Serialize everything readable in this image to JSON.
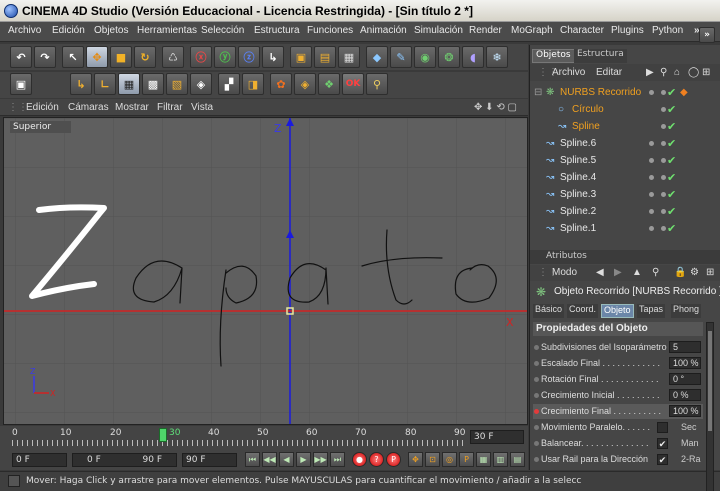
{
  "titlebar": {
    "title": "CINEMA 4D Studio (Versión Educacional - Licencia Restringida) - [Sin título 2 *]"
  },
  "menu": [
    "Archivo",
    "Edición",
    "Objetos",
    "Herramientas",
    "Selección",
    "Estructura",
    "Funciones",
    "Animación",
    "Simulación",
    "Render",
    "MoGraph",
    "Character",
    "Plugins",
    "Python"
  ],
  "viewport": {
    "menu": [
      "Edición",
      "Cámaras",
      "Mostrar",
      "Filtrar",
      "Vista"
    ],
    "label": "Superior",
    "axis_z": "Z",
    "axis_x": "X",
    "handwritten_text": "Zapato"
  },
  "timeline": {
    "ticks": [
      "0",
      "10",
      "20",
      "30",
      "40",
      "50",
      "60",
      "70",
      "80",
      "90"
    ],
    "current_frame": "30",
    "end_field": "30 F",
    "start_field": "0 F",
    "min_field": "0 F",
    "max_field": "90 F",
    "len_field": "90 F"
  },
  "status": "Mover: Haga Click y arrastre para mover elementos. Pulse MAYUSCULAS para cuantificar el movimiento / añadir a la selecc",
  "objects_panel": {
    "tabs": [
      "Objetos",
      "Estructura"
    ],
    "menu": [
      "Archivo",
      "Editar"
    ],
    "items": [
      {
        "name": "NURBS Recorrido",
        "highlight": true
      },
      {
        "name": "Círculo",
        "child": true
      },
      {
        "name": "Spline",
        "child": true
      },
      {
        "name": "Spline.6"
      },
      {
        "name": "Spline.5"
      },
      {
        "name": "Spline.4"
      },
      {
        "name": "Spline.3"
      },
      {
        "name": "Spline.2"
      },
      {
        "name": "Spline.1"
      }
    ]
  },
  "attributes_panel": {
    "header": "Atributos",
    "menu": "Modo",
    "object_title": "Objeto Recorrido [NURBS Recorrido ]",
    "tabs": [
      "Básico",
      "Coord.",
      "Objeto",
      "Tapas",
      "Phong"
    ],
    "active_tab": "Objeto",
    "section": "Propiedades del Objeto",
    "rows": [
      {
        "label": "Subdivisiones del Isoparámetro",
        "value": "5"
      },
      {
        "label": "Escalado Final . . . . . . . . . . . .",
        "value": "100 %"
      },
      {
        "label": "Rotación Final . . . . . . . . . . . .",
        "value": "0 °"
      },
      {
        "label": "Crecimiento Inicial . . . . . . . . .",
        "value": "0 %"
      },
      {
        "label": "Crecimiento Final . . . . . . . . . .",
        "value": "100 %",
        "red": true
      },
      {
        "label": "Movimiento Paralelo. . . . . .",
        "check": "",
        "right": "Sec"
      },
      {
        "label": "Balancear. . . . . . . . . . . . . .",
        "check": "✔",
        "right": "Man"
      },
      {
        "label": "Usar Rail para la Dirección",
        "check": "✔",
        "right": "2-Ra"
      }
    ]
  },
  "colors": {
    "accent_orange": "#f0a020",
    "selection_blue": "#6b86a8",
    "axis_blue": "#1a1adf",
    "axis_red": "#d22222"
  }
}
